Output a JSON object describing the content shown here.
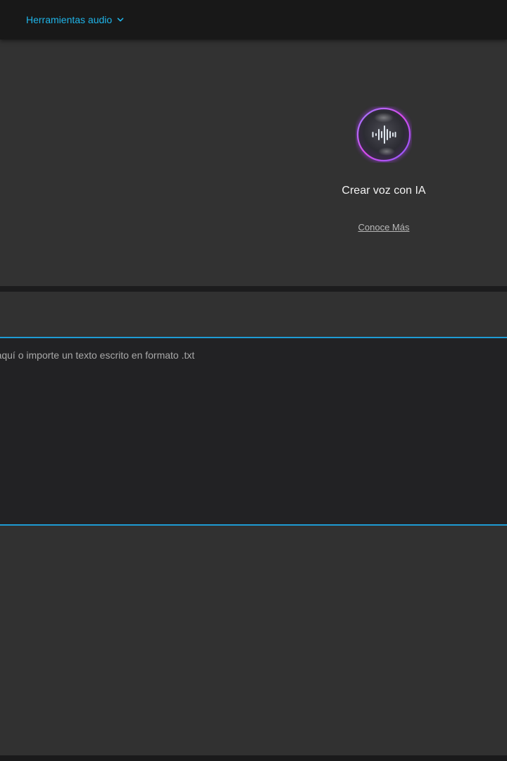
{
  "header": {
    "tools_menu_label": "Herramientas audio",
    "accent_color": "#1fb4e8"
  },
  "voice_feature": {
    "icon": "sound-wave-icon",
    "title": "Crear voz con IA",
    "learn_more": "Conoce Más"
  },
  "editor": {
    "placeholder": "Escriba aquí o importe un texto escrito en formato .txt",
    "value": "",
    "border_color": "#1e9bd4"
  }
}
